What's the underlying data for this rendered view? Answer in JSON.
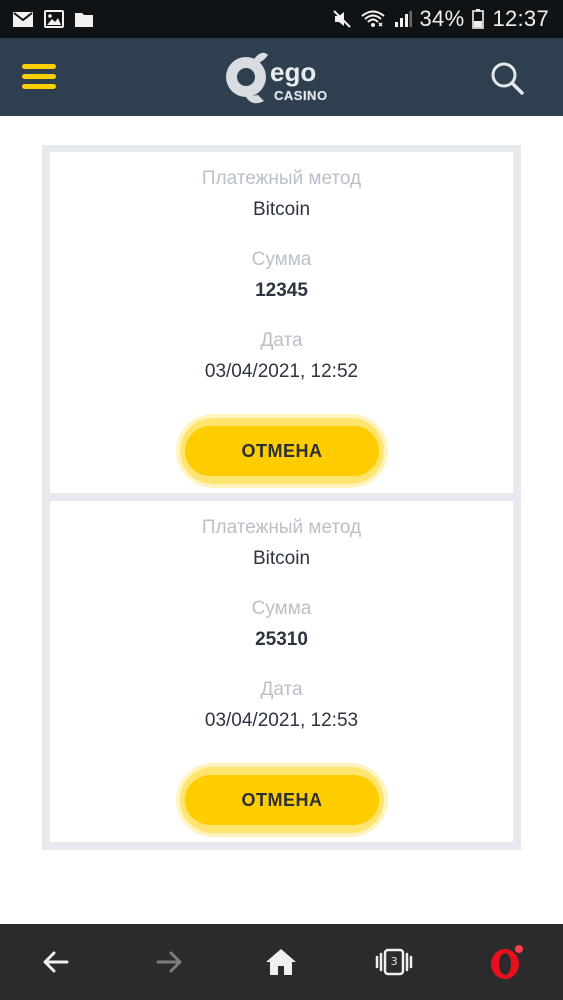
{
  "status_bar": {
    "battery_percent": "34%",
    "time": "12:37",
    "icons": [
      "mail-icon",
      "image-icon",
      "folder-icon",
      "mute-icon",
      "wifi-icon",
      "signal-icon",
      "battery-icon"
    ]
  },
  "header": {
    "logo": {
      "main": "ego",
      "sub": "CASINO"
    },
    "icons": [
      "menu-icon",
      "search-icon"
    ]
  },
  "transactions": [
    {
      "method_label": "Платежный метод",
      "method": "Bitcoin",
      "amount_label": "Сумма",
      "amount": "12345",
      "date_label": "Дата",
      "date": "03/04/2021, 12:52",
      "cancel_label": "ОТМЕНА"
    },
    {
      "method_label": "Платежный метод",
      "method": "Bitcoin",
      "amount_label": "Сумма",
      "amount": "25310",
      "date_label": "Дата",
      "date": "03/04/2021, 12:53",
      "cancel_label": "ОТМЕНА"
    }
  ],
  "bottom_nav": {
    "tabs_count": "3",
    "icons": [
      "back-arrow-icon",
      "forward-arrow-icon",
      "home-icon",
      "tabs-icon",
      "opera-icon"
    ]
  },
  "colors": {
    "accent": "#ffcc00",
    "header_bg": "#2e3f4f",
    "status_bg": "#101316",
    "bottom_bg": "#2b2b2d",
    "list_bg": "#e6e9ee"
  }
}
